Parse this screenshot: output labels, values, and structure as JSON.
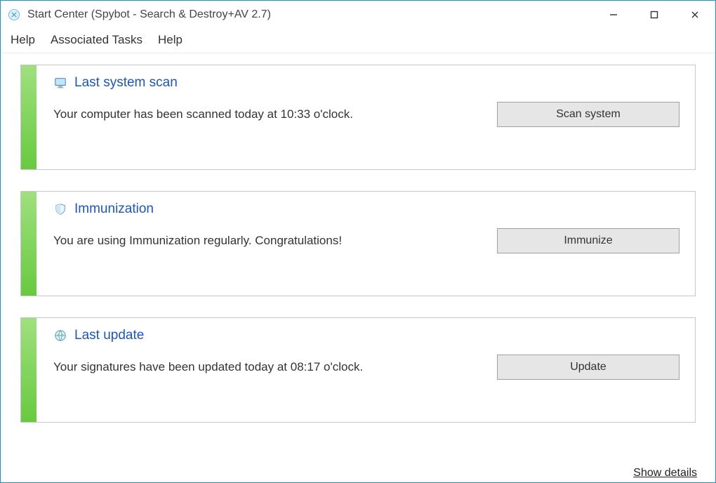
{
  "window": {
    "title": "Start Center (Spybot - Search & Destroy+AV 2.7)"
  },
  "menubar": {
    "items": [
      "Help",
      "Associated Tasks",
      "Help"
    ]
  },
  "cards": [
    {
      "title": "Last system scan",
      "description": "Your computer has been scanned today at 10:33 o'clock.",
      "button": "Scan system"
    },
    {
      "title": "Immunization",
      "description": "You are using Immunization regularly. Congratulations!",
      "button": "Immunize"
    },
    {
      "title": "Last update",
      "description": "Your signatures have been updated today at 08:17 o'clock.",
      "button": "Update"
    }
  ],
  "footer": {
    "show_details": "Show details"
  }
}
